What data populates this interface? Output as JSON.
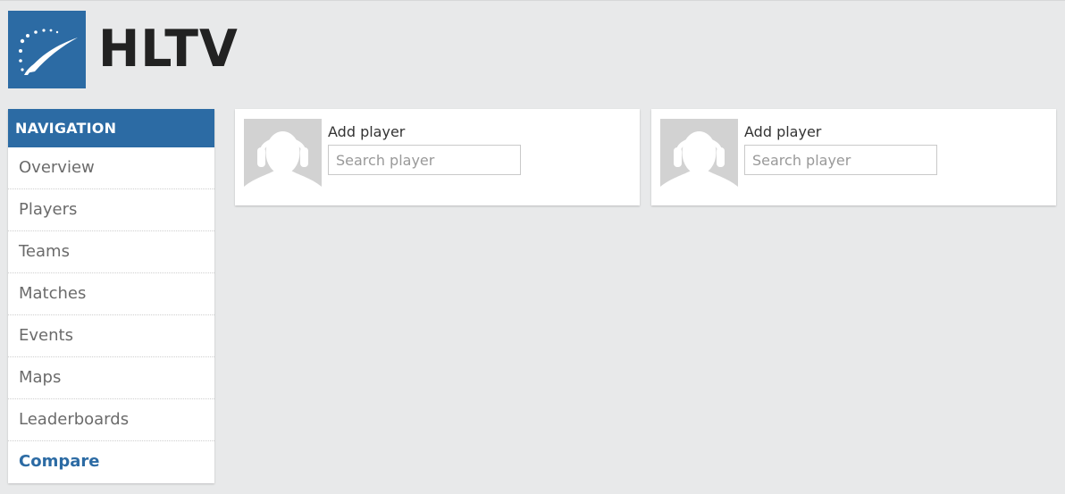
{
  "brand": {
    "name": "HLTV",
    "colors": {
      "primary": "#2c6ba4",
      "background": "#e8e9ea",
      "text": "#222222"
    }
  },
  "navigation": {
    "header": "NAVIGATION",
    "items": [
      {
        "label": "Overview",
        "active": false
      },
      {
        "label": "Players",
        "active": false
      },
      {
        "label": "Teams",
        "active": false
      },
      {
        "label": "Matches",
        "active": false
      },
      {
        "label": "Events",
        "active": false
      },
      {
        "label": "Maps",
        "active": false
      },
      {
        "label": "Leaderboards",
        "active": false
      },
      {
        "label": "Compare",
        "active": true
      }
    ]
  },
  "compare": {
    "players": [
      {
        "label": "Add player",
        "search_placeholder": "Search player",
        "search_value": "",
        "avatar_icon": "player-silhouette-icon"
      },
      {
        "label": "Add player",
        "search_placeholder": "Search player",
        "search_value": "",
        "avatar_icon": "player-silhouette-icon"
      }
    ]
  }
}
